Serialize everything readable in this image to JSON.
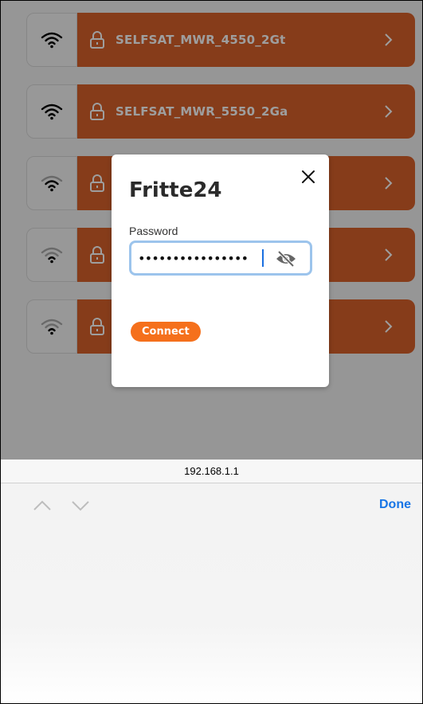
{
  "networks": [
    {
      "name": "SELFSAT_MWR_4550_2Gt",
      "signal": "strong"
    },
    {
      "name": "SELFSAT_MWR_5550_2Ga",
      "signal": "strong"
    },
    {
      "name": "",
      "signal": "medium"
    },
    {
      "name": "",
      "signal": "weak"
    },
    {
      "name": "",
      "signal": "weak"
    }
  ],
  "modal": {
    "title": "Fritte24",
    "password_label": "Password",
    "password_value": "••••••••••••••••",
    "connect_label": "Connect"
  },
  "browser": {
    "url": "192.168.1.1",
    "done_label": "Done"
  },
  "colors": {
    "network_bar": "#d9622b",
    "connect_button": "#f5701c",
    "focus_ring": "#9cc4ec",
    "done_link": "#1875e6"
  },
  "icons": [
    "wifi-icon",
    "lock-icon",
    "chevron-right-icon",
    "close-icon",
    "eye-slash-icon",
    "chevron-up-icon",
    "chevron-down-icon"
  ]
}
